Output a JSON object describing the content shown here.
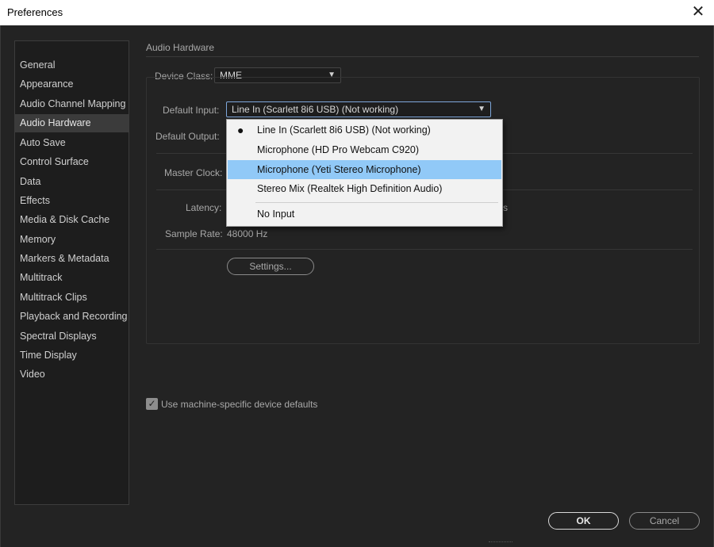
{
  "window": {
    "title": "Preferences",
    "close_glyph": "✕"
  },
  "sidebar": {
    "items": [
      {
        "label": "General"
      },
      {
        "label": "Appearance"
      },
      {
        "label": "Audio Channel Mapping"
      },
      {
        "label": "Audio Hardware",
        "selected": true
      },
      {
        "label": "Auto Save"
      },
      {
        "label": "Control Surface"
      },
      {
        "label": "Data"
      },
      {
        "label": "Effects"
      },
      {
        "label": "Media & Disk Cache"
      },
      {
        "label": "Memory"
      },
      {
        "label": "Markers & Metadata"
      },
      {
        "label": "Multitrack"
      },
      {
        "label": "Multitrack Clips"
      },
      {
        "label": "Playback and Recording"
      },
      {
        "label": "Spectral Displays"
      },
      {
        "label": "Time Display"
      },
      {
        "label": "Video"
      }
    ]
  },
  "main": {
    "section_title": "Audio Hardware",
    "device_class": {
      "label": "Device Class:",
      "value": "MME"
    },
    "default_input": {
      "label": "Default Input:",
      "value": "Line In (Scarlett 8i6 USB) (Not working)"
    },
    "default_output": {
      "label": "Default Output:"
    },
    "master_clock": {
      "label": "Master Clock:"
    },
    "latency": {
      "label": "Latency:",
      "suffix": "s"
    },
    "sample_rate": {
      "label": "Sample Rate:",
      "value": "48000 Hz"
    },
    "settings_button": "Settings...",
    "machine_defaults": {
      "label": "Use machine-specific device defaults",
      "checked": true
    }
  },
  "dropdown": {
    "options": [
      {
        "label": "Line In (Scarlett 8i6 USB) (Not working)",
        "selected": true
      },
      {
        "label": "Microphone (HD Pro Webcam C920)"
      },
      {
        "label": "Microphone (Yeti Stereo Microphone)",
        "highlighted": true
      },
      {
        "label": "Stereo Mix (Realtek High Definition Audio)"
      },
      {
        "label": "No Input"
      }
    ],
    "bullet": "●"
  },
  "footer": {
    "ok_label": "OK",
    "cancel_label": "Cancel"
  },
  "colors": {
    "background": "#232323",
    "sidebar_bg": "#1d1d1d",
    "selected_item": "#3b3b3b",
    "dropdown_highlight": "#91c9f7",
    "focus_border": "#7ea7db"
  },
  "icons": {
    "close": "close-icon",
    "chevron": "chevron-down-icon",
    "checkmark": "checkmark-icon"
  }
}
